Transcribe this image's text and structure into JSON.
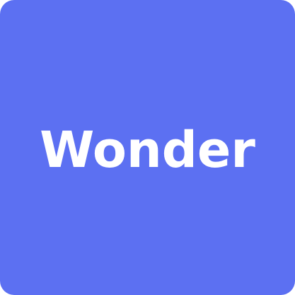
{
  "icon": {
    "label": "Wonder",
    "background_color": "#5C70F2",
    "text_color": "#FFFFFF"
  }
}
